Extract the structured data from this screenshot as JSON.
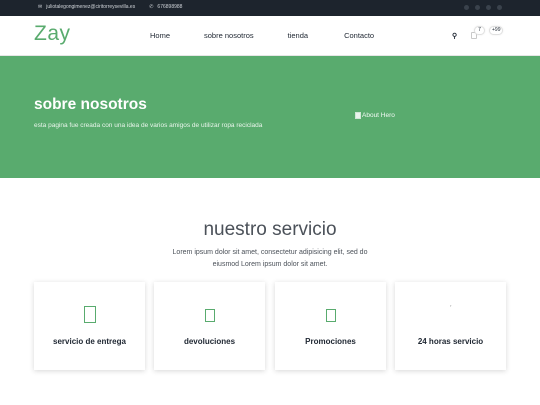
{
  "topbar": {
    "email": "juliotalegongimenez@ciritorreysevilla.es",
    "phone": "676898988",
    "email_icon": "envelope-icon",
    "phone_icon": "phone-icon"
  },
  "header": {
    "logo": "Zay",
    "nav": [
      "Home",
      "sobre nosotros",
      "tienda",
      "Contacto"
    ],
    "cart_count": "7",
    "user_count": "+99"
  },
  "hero": {
    "title": "sobre nosotros",
    "subtitle": "esta pagina fue creada con una idea de varios amigos de utilizar ropa reciclada",
    "image_alt": "About Hero"
  },
  "services": {
    "title": "nuestro servicio",
    "description": "Lorem ipsum dolor sit amet, consectetur adipisicing elit, sed do eiusmod Lorem ipsum dolor sit amet.",
    "cards": [
      {
        "label": "servicio de entrega",
        "icon": "truck-icon"
      },
      {
        "label": "devoluciones",
        "icon": "exchange-icon"
      },
      {
        "label": "Promociones",
        "icon": "percent-icon"
      },
      {
        "label": "24 horas servicio",
        "icon": "user-icon"
      }
    ]
  },
  "colors": {
    "brand": "#59ab6e",
    "topbar": "#1d242d"
  }
}
